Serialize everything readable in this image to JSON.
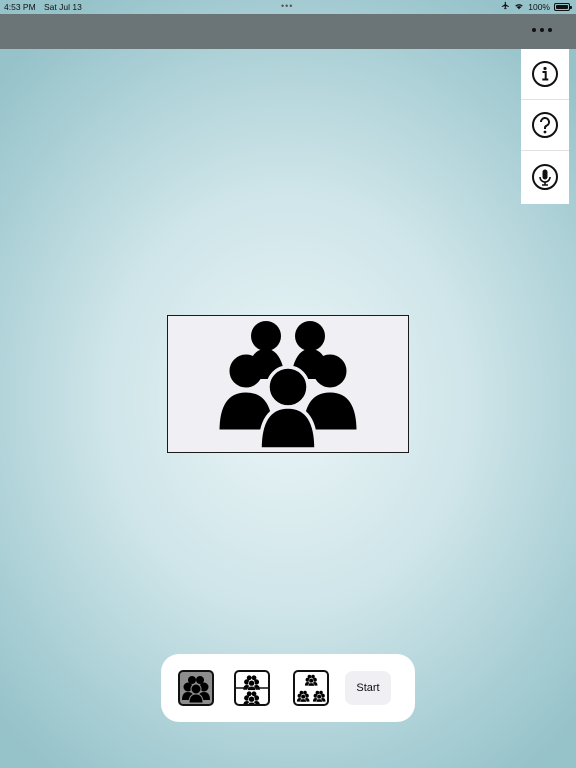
{
  "status_bar": {
    "time": "4:53 PM",
    "date": "Sat Jul 13",
    "battery": "100%",
    "icons": [
      "airplane-icon",
      "wifi-icon",
      "battery-icon"
    ]
  },
  "top_bar": {
    "more_icon": "more-horizontal-icon"
  },
  "side_panel": {
    "items": [
      {
        "icon": "info-icon"
      },
      {
        "icon": "help-icon"
      },
      {
        "icon": "microphone-icon"
      }
    ]
  },
  "main": {
    "image_icon": "group-of-people-icon"
  },
  "toolbar": {
    "modes": [
      {
        "icon": "single-group-icon",
        "selected": true
      },
      {
        "icon": "two-groups-icon",
        "selected": false
      },
      {
        "icon": "four-groups-icon",
        "selected": false
      }
    ],
    "start_label": "Start"
  },
  "colors": {
    "top_bar": "#6b7477",
    "background": "#cfe5e9",
    "selected_mode": "#8d8d8d"
  }
}
